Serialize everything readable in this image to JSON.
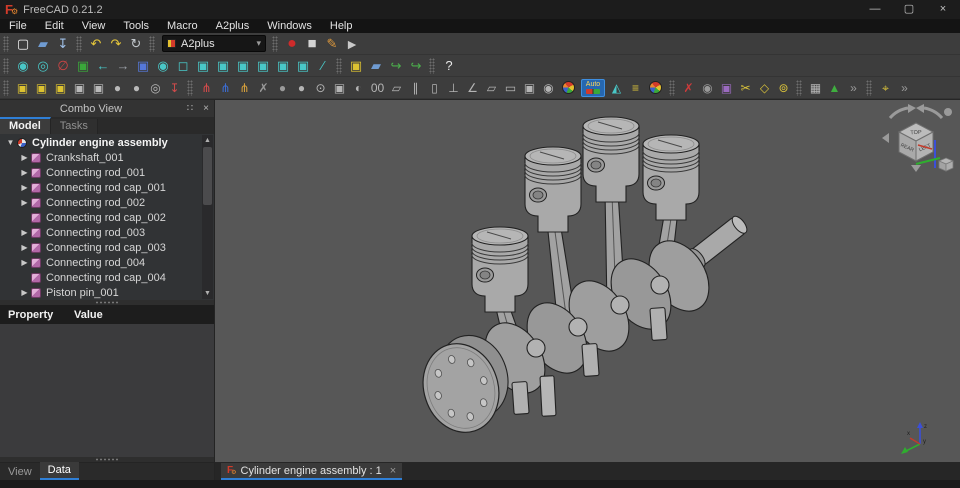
{
  "window": {
    "title": "FreeCAD 0.21.2",
    "app_icon_glyph": "F",
    "gear_glyph": "⚙",
    "minimize": "—",
    "maximize": "▢",
    "close": "×"
  },
  "menubar": {
    "items": [
      "File",
      "Edit",
      "View",
      "Tools",
      "Macro",
      "A2plus",
      "Windows",
      "Help"
    ]
  },
  "toolbars": {
    "workbench_selector": {
      "label": "A2plus",
      "chevron": "▾"
    },
    "rows": [
      {
        "toolbars": [
          {
            "name": "file",
            "buttons": [
              {
                "name": "new-document",
                "glyph": "▢",
                "color": "#f0f0f0"
              },
              {
                "name": "open-document",
                "glyph": "▰",
                "color": "#6f9bd1"
              },
              {
                "name": "save-document",
                "glyph": "↧",
                "color": "#9fc0e8"
              }
            ]
          },
          {
            "name": "edit",
            "buttons": [
              {
                "name": "undo",
                "glyph": "↶",
                "color": "#e7c83b"
              },
              {
                "name": "redo",
                "glyph": "↷",
                "color": "#e7c83b"
              },
              {
                "name": "refresh",
                "glyph": "↻",
                "color": "#c2c7cc"
              }
            ]
          },
          {
            "name": "workbench",
            "buttons": [
              {
                "name": "workbench-selector",
                "type": "dropdown"
              }
            ]
          },
          {
            "name": "macro",
            "buttons": [
              {
                "name": "macro-record",
                "glyph": "●",
                "color": "#cf2b2b",
                "size": 16
              },
              {
                "name": "macro-stop",
                "glyph": "■",
                "color": "#d4d4d4",
                "size": 15
              },
              {
                "name": "macro-edit",
                "glyph": "✎",
                "color": "#e09a3c"
              },
              {
                "name": "macro-play",
                "glyph": "►",
                "color": "#c9c9c9",
                "size": 14
              }
            ]
          }
        ]
      },
      {
        "toolbars": [
          {
            "name": "view",
            "buttons": [
              {
                "name": "fit-all",
                "glyph": "◉",
                "color": "#49c8c8"
              },
              {
                "name": "box-zoom",
                "glyph": "◎",
                "color": "#49c8c8"
              },
              {
                "name": "draw-style",
                "glyph": "∅",
                "color": "#d04545"
              },
              {
                "name": "select-element",
                "glyph": "▣",
                "color": "#3aa83a"
              },
              {
                "name": "nav-back",
                "glyph": "←",
                "color": "#49c8c8"
              },
              {
                "name": "nav-forward",
                "glyph": "→",
                "color": "#9aa0a6"
              },
              {
                "name": "home-view",
                "glyph": "▣",
                "color": "#5577d9"
              },
              {
                "name": "fit-selection",
                "glyph": "◉",
                "color": "#49c8c8"
              },
              {
                "name": "axonometric-view",
                "glyph": "◻",
                "color": "#49c8c8"
              },
              {
                "name": "front-view",
                "glyph": "▣",
                "color": "#49c8c8"
              },
              {
                "name": "top-view",
                "glyph": "▣",
                "color": "#49c8c8"
              },
              {
                "name": "right-view",
                "glyph": "▣",
                "color": "#49c8c8"
              },
              {
                "name": "rear-view",
                "glyph": "▣",
                "color": "#49c8c8"
              },
              {
                "name": "bottom-view",
                "glyph": "▣",
                "color": "#49c8c8"
              },
              {
                "name": "left-view",
                "glyph": "▣",
                "color": "#49c8c8"
              },
              {
                "name": "measure-distance",
                "glyph": "∕",
                "color": "#49c8c8"
              }
            ]
          },
          {
            "name": "structure",
            "buttons": [
              {
                "name": "create-part",
                "glyph": "▣",
                "color": "#dcc231"
              },
              {
                "name": "create-group",
                "glyph": "▰",
                "color": "#6f9bd1"
              },
              {
                "name": "make-link",
                "glyph": "↪",
                "color": "#4cae4c"
              },
              {
                "name": "make-sub-link",
                "glyph": "↪",
                "color": "#4cae4c"
              }
            ]
          },
          {
            "name": "help",
            "buttons": [
              {
                "name": "whats-this",
                "glyph": "?",
                "color": "#e8e8e8"
              }
            ]
          }
        ]
      },
      {
        "toolbars": [
          {
            "name": "a2p-part",
            "buttons": [
              {
                "name": "a2p-import-part",
                "glyph": "▣",
                "color": "#dcc231"
              },
              {
                "name": "a2p-import-part-update",
                "glyph": "▣",
                "color": "#dcc231"
              },
              {
                "name": "a2p-update-imported-parts",
                "glyph": "▣",
                "color": "#dcc231"
              },
              {
                "name": "a2p-edit-imported-part",
                "glyph": "▣",
                "color": "#b9b9b9"
              },
              {
                "name": "a2p-move-part",
                "glyph": "▣",
                "color": "#b9b9b9"
              },
              {
                "name": "a2p-place-part",
                "glyph": "●",
                "color": "#b9b9b9"
              },
              {
                "name": "a2p-duplicate-part",
                "glyph": "●",
                "color": "#b9b9b9"
              },
              {
                "name": "a2p-shape-ring",
                "glyph": "◎",
                "color": "#b9b9b9"
              },
              {
                "name": "a2p-save-and-exit",
                "glyph": "↧",
                "color": "#cf4b4b"
              }
            ]
          },
          {
            "name": "a2p-constraints",
            "buttons": [
              {
                "name": "a2p-constraint-tripod-1",
                "glyph": "⋔",
                "color": "#d94b4b"
              },
              {
                "name": "a2p-constraint-tripod-2",
                "glyph": "⋔",
                "color": "#3b6fd9"
              },
              {
                "name": "a2p-constraint-tripod-3",
                "glyph": "⋔",
                "color": "#d9a23b"
              },
              {
                "name": "a2p-delete-constraint",
                "glyph": "✗",
                "color": "#9a9a9a"
              },
              {
                "name": "a2p-circular-edge",
                "glyph": "●",
                "color": "#9a9a9a"
              },
              {
                "name": "a2p-point-identity",
                "glyph": "●",
                "color": "#b5b5b5"
              },
              {
                "name": "a2p-point-on-line",
                "glyph": "⊙",
                "color": "#b5b5b5"
              },
              {
                "name": "a2p-point-on-plane",
                "glyph": "▣",
                "color": "#b5b5b5"
              },
              {
                "name": "a2p-sphere-center",
                "glyph": "◐",
                "color": "#b5b5b5"
              },
              {
                "name": "a2p-circular-edge-connect",
                "glyph": "00",
                "color": "#b5b5b5"
              },
              {
                "name": "a2p-axis-coincident",
                "glyph": "▱",
                "color": "#b5b5b5"
              },
              {
                "name": "a2p-axis-parallel",
                "glyph": "∥",
                "color": "#b5b5b5"
              },
              {
                "name": "a2p-axis-plane-parallel",
                "glyph": "▯",
                "color": "#b5b5b5"
              },
              {
                "name": "a2p-axis-plane-normal",
                "glyph": "⊥",
                "color": "#b5b5b5"
              },
              {
                "name": "a2p-angled-planes",
                "glyph": "∠",
                "color": "#b5b5b5"
              },
              {
                "name": "a2p-planes-parallel",
                "glyph": "▱",
                "color": "#b5b5b5"
              },
              {
                "name": "a2p-plane-coincident",
                "glyph": "▭",
                "color": "#b5b5b5"
              },
              {
                "name": "a2p-center-of-mass",
                "glyph": "▣",
                "color": "#b5b5b5"
              },
              {
                "name": "a2p-lock-rotation",
                "glyph": "◉",
                "color": "#b5b5b5"
              },
              {
                "name": "a2p-solve",
                "type": "ball"
              },
              {
                "name": "a2p-auto-solve-toggle",
                "type": "chip",
                "label": "Auto"
              },
              {
                "name": "a2p-mirror",
                "glyph": "◭",
                "color": "#49c8c8"
              },
              {
                "name": "a2p-constraint-manager",
                "glyph": "≡",
                "color": "#d9c23b"
              },
              {
                "name": "a2p-edit-tool",
                "type": "ball"
              }
            ]
          },
          {
            "name": "a2p-tools",
            "buttons": [
              {
                "name": "a2p-flip-constraint",
                "glyph": "✗",
                "color": "#cf3b3b"
              },
              {
                "name": "a2p-find-constraint",
                "glyph": "◉",
                "color": "#9a9a9a"
              },
              {
                "name": "a2p-show-hide-parts",
                "glyph": "▣",
                "color": "#9b6bc0"
              },
              {
                "name": "a2p-suppress-constraint",
                "glyph": "✂",
                "color": "#d9c23b"
              },
              {
                "name": "a2p-show-labels",
                "glyph": "◇",
                "color": "#d9c23b"
              },
              {
                "name": "a2p-show-dof",
                "glyph": "⊚",
                "color": "#d9c23b"
              }
            ]
          },
          {
            "name": "a2p-misc",
            "buttons": [
              {
                "name": "a2p-convert-absolute",
                "glyph": "▦",
                "color": "#b5b5b5"
              },
              {
                "name": "a2p-hierarchy-tree",
                "glyph": "▲",
                "color": "#3fae3f"
              },
              {
                "name": "toolbar-overflow-1",
                "glyph": "»",
                "color": "#9a9a9a"
              }
            ]
          },
          {
            "name": "a2p-extra",
            "buttons": [
              {
                "name": "a2p-lamp-tool",
                "glyph": "⌖",
                "color": "#d9c23b"
              },
              {
                "name": "toolbar-overflow-2",
                "glyph": "»",
                "color": "#9a9a9a"
              }
            ]
          }
        ]
      }
    ]
  },
  "combo_view": {
    "title": "Combo View",
    "float_glyph": "∷",
    "close_glyph": "×",
    "tabs": [
      {
        "label": "Model",
        "active": true
      },
      {
        "label": "Tasks",
        "active": false
      }
    ],
    "tree": {
      "items": [
        {
          "label": "Cylinder engine assembly",
          "icon": "document",
          "expander": "open",
          "bold": true,
          "level": 0
        },
        {
          "label": "Crankshaft_001",
          "icon": "part",
          "expander": "closed",
          "level": 1
        },
        {
          "label": "Connecting rod_001",
          "icon": "part",
          "expander": "closed",
          "level": 1
        },
        {
          "label": "Connecting rod cap_001",
          "icon": "part",
          "expander": "closed",
          "level": 1
        },
        {
          "label": "Connecting rod_002",
          "icon": "part",
          "expander": "closed",
          "level": 1
        },
        {
          "label": "Connecting rod cap_002",
          "icon": "part",
          "expander": null,
          "level": 1
        },
        {
          "label": "Connecting rod_003",
          "icon": "part",
          "expander": "closed",
          "level": 1
        },
        {
          "label": "Connecting rod cap_003",
          "icon": "part",
          "expander": "closed",
          "level": 1
        },
        {
          "label": "Connecting rod_004",
          "icon": "part",
          "expander": "closed",
          "level": 1
        },
        {
          "label": "Connecting rod cap_004",
          "icon": "part",
          "expander": null,
          "level": 1
        },
        {
          "label": "Piston pin_001",
          "icon": "part",
          "expander": "closed",
          "level": 1
        }
      ],
      "scroll_up_glyph": "▲",
      "scroll_down_glyph": "▼"
    },
    "property_table": {
      "columns": [
        "Property",
        "Value"
      ],
      "rows": []
    },
    "bottom_tabs": [
      {
        "label": "View",
        "active": false
      },
      {
        "label": "Data",
        "active": true
      }
    ]
  },
  "viewport": {
    "document_tab": {
      "label": "Cylinder engine assembly : 1",
      "close_glyph": "×"
    },
    "nav_cube": {
      "faces": [
        "TOP",
        "REAR",
        "LEFT"
      ]
    },
    "axis_indicator": {
      "labels": [
        "x",
        "y",
        "z"
      ]
    }
  },
  "colors": {
    "accent": "#2f7fd6",
    "viewport_bg": "#575757",
    "model_fill": "#a8a8a8",
    "model_edge": "#222222",
    "axis_x": "#c23b2b",
    "axis_y": "#2fae2f",
    "axis_z": "#3b4fd8"
  }
}
